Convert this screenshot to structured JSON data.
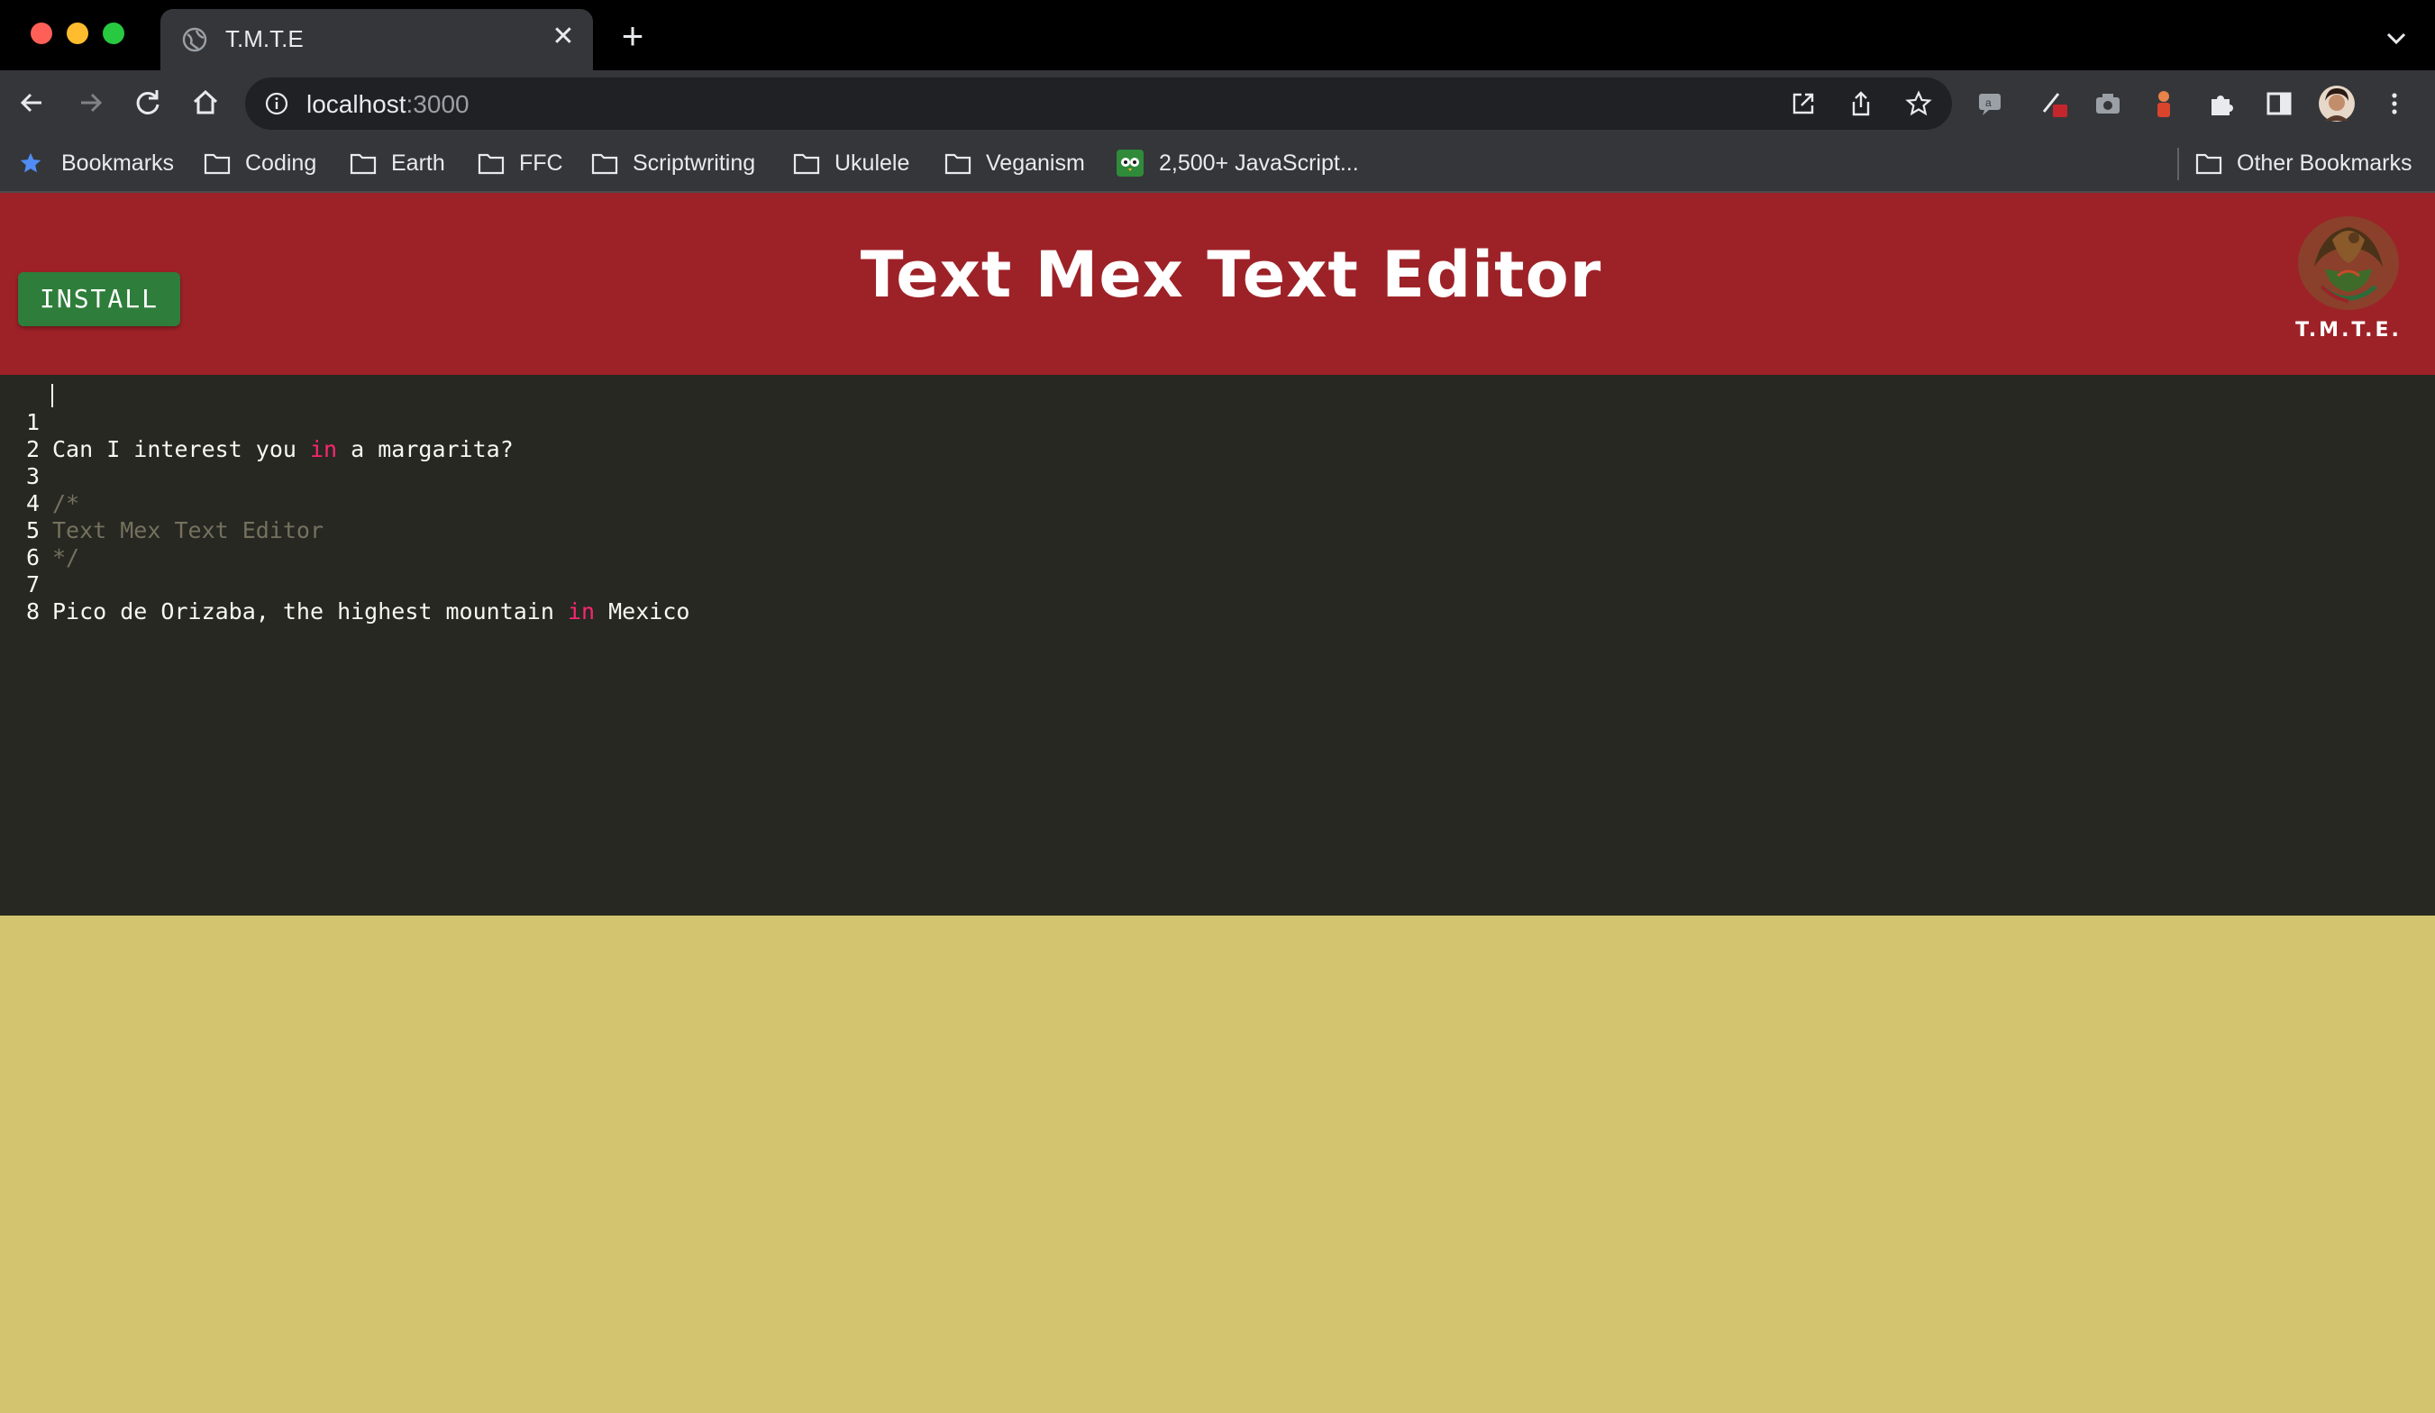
{
  "browser": {
    "tab_title": "T.M.T.E",
    "url_host": "localhost",
    "url_port": ":3000",
    "bookmarks": [
      {
        "label": "Bookmarks",
        "icon": "star-icon"
      },
      {
        "label": "Coding",
        "icon": "folder-icon"
      },
      {
        "label": "Earth",
        "icon": "folder-icon"
      },
      {
        "label": "FFC",
        "icon": "folder-icon"
      },
      {
        "label": "Scriptwriting",
        "icon": "folder-icon"
      },
      {
        "label": "Ukulele",
        "icon": "folder-icon"
      },
      {
        "label": "Veganism",
        "icon": "folder-icon"
      },
      {
        "label": "2,500+ JavaScript...",
        "icon": "owl-favicon-icon"
      }
    ],
    "other_bookmarks": "Other Bookmarks"
  },
  "header": {
    "install_label": "INSTALL",
    "title": "Text Mex Text Editor",
    "logo_text": "T.M.T.E."
  },
  "editor": {
    "lines": [
      {
        "num": "1",
        "segments": [
          {
            "t": "Can I interest you ",
            "c": "plain"
          },
          {
            "t": "in",
            "c": "kw"
          },
          {
            "t": " a margarita?",
            "c": "plain"
          }
        ]
      },
      {
        "num": "2",
        "segments": []
      },
      {
        "num": "3",
        "segments": [
          {
            "t": "/*",
            "c": "comment"
          }
        ]
      },
      {
        "num": "4",
        "segments": [
          {
            "t": "Text Mex Text Editor",
            "c": "comment"
          }
        ]
      },
      {
        "num": "5",
        "segments": [
          {
            "t": "*/",
            "c": "comment"
          }
        ]
      },
      {
        "num": "6",
        "segments": []
      },
      {
        "num": "7",
        "segments": [
          {
            "t": "Pico de Orizaba, the highest mountain ",
            "c": "plain"
          },
          {
            "t": "in",
            "c": "kw"
          },
          {
            "t": " Mexico",
            "c": "plain"
          }
        ]
      },
      {
        "num": "8",
        "segments": []
      }
    ]
  },
  "colors": {
    "header_red": "#9d2228",
    "install_green": "#2e7d3a",
    "editor_bg": "#272822",
    "page_bg": "#d3c46f",
    "keyword": "#f92672",
    "comment": "#75715e"
  }
}
